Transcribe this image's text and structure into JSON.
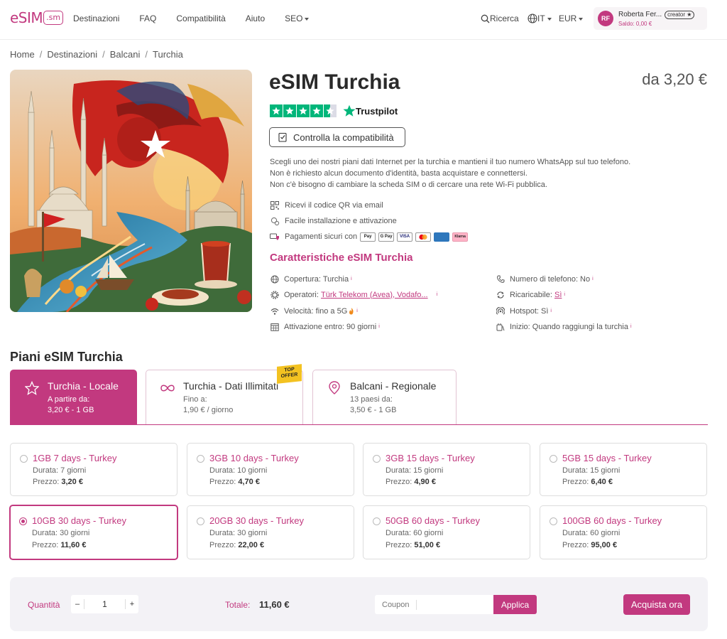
{
  "header": {
    "logo_text": "eSIM",
    "logo_box": ".sm",
    "nav": [
      "Destinazioni",
      "FAQ",
      "Compatibilità",
      "Aiuto",
      "SEO"
    ],
    "search_label": "Ricerca",
    "lang": "IT",
    "currency": "EUR",
    "user": {
      "initials": "RF",
      "name": "Roberta Fer...",
      "badge": "creator ★",
      "balance": "Saldo: 0,00 €"
    }
  },
  "breadcrumb": [
    "Home",
    "Destinazioni",
    "Balcani",
    "Turchia"
  ],
  "product": {
    "title": "eSIM Turchia",
    "price_from": "da 3,20 €",
    "trustpilot_label": "Trustpilot",
    "trustpilot_rating": 4.5,
    "compat_button": "Controlla la compatibilità",
    "description": [
      "Scegli uno dei nostri piani dati Internet per la turchia e mantieni il tuo numero WhatsApp sul tuo telefono.",
      "Non è richiesto alcun documento d'identità, basta acquistare e connettersi.",
      "Non c'è bisogno di cambiare la scheda SIM o di cercare una rete Wi-Fi pubblica."
    ],
    "features": {
      "qr": "Ricevi il codice QR via email",
      "install": "Facile installazione e attivazione",
      "payments": "Pagamenti sicuri con"
    },
    "payment_methods": [
      "Pay",
      "G Pay",
      "VISA",
      "MC",
      "AMEX",
      "Klarna"
    ],
    "specs_title": "Caratteristiche eSIM Turchia",
    "specs": {
      "coverage": "Copertura: Turchia",
      "operators_label": "Operatori:",
      "operators_value": "Türk Telekom (Avea), Vodafo...",
      "speed": "Velocità: fino a 5G",
      "activation": "Attivazione entro: 90 giorni",
      "phone": "Numero di telefono: No",
      "rechargeable_label": "Ricaricabile:",
      "rechargeable_value": "Sì",
      "hotspot": "Hotspot: Sì",
      "start": "Inizio: Quando raggiungi la turchia"
    },
    "info_mark": "i"
  },
  "plans": {
    "title": "Piani eSIM Turchia",
    "tabs": [
      {
        "title": "Turchia - Locale",
        "sub1": "A partire da:",
        "sub2": "3,20 € - 1 GB"
      },
      {
        "title": "Turchia - Dati Illimitati",
        "sub1": "Fino a:",
        "sub2": "1,90 € / giorno",
        "ribbon": [
          "TOP",
          "OFFER"
        ]
      },
      {
        "title": "Balcani - Regionale",
        "sub1": "13 paesi da:",
        "sub2": "3,50 € - 1 GB"
      }
    ],
    "duration_label": "Durata:",
    "price_label": "Prezzo:",
    "cards": [
      {
        "title": "1GB 7 days - Turkey",
        "duration": "7 giorni",
        "price": "3,20 €"
      },
      {
        "title": "3GB 10 days - Turkey",
        "duration": "10 giorni",
        "price": "4,70 €"
      },
      {
        "title": "3GB 15 days - Turkey",
        "duration": "15 giorni",
        "price": "4,90 €"
      },
      {
        "title": "5GB 15 days - Turkey",
        "duration": "15 giorni",
        "price": "6,40 €"
      },
      {
        "title": "10GB 30 days - Turkey",
        "duration": "30 giorni",
        "price": "11,60 €"
      },
      {
        "title": "20GB 30 days - Turkey",
        "duration": "30 giorni",
        "price": "22,00 €"
      },
      {
        "title": "50GB 60 days - Turkey",
        "duration": "60 giorni",
        "price": "51,00 €"
      },
      {
        "title": "100GB 60 days - Turkey",
        "duration": "60 giorni",
        "price": "95,00 €"
      }
    ]
  },
  "checkout": {
    "qty_label": "Quantità",
    "minus": "–",
    "qty": "1",
    "plus": "+",
    "total_label": "Totale:",
    "total": "11,60 €",
    "coupon_placeholder": "Coupon",
    "apply": "Applica",
    "buy": "Acquista ora"
  },
  "colors": {
    "accent": "#c2397f",
    "trustpilot": "#00b67a",
    "offer": "#f3c221"
  }
}
